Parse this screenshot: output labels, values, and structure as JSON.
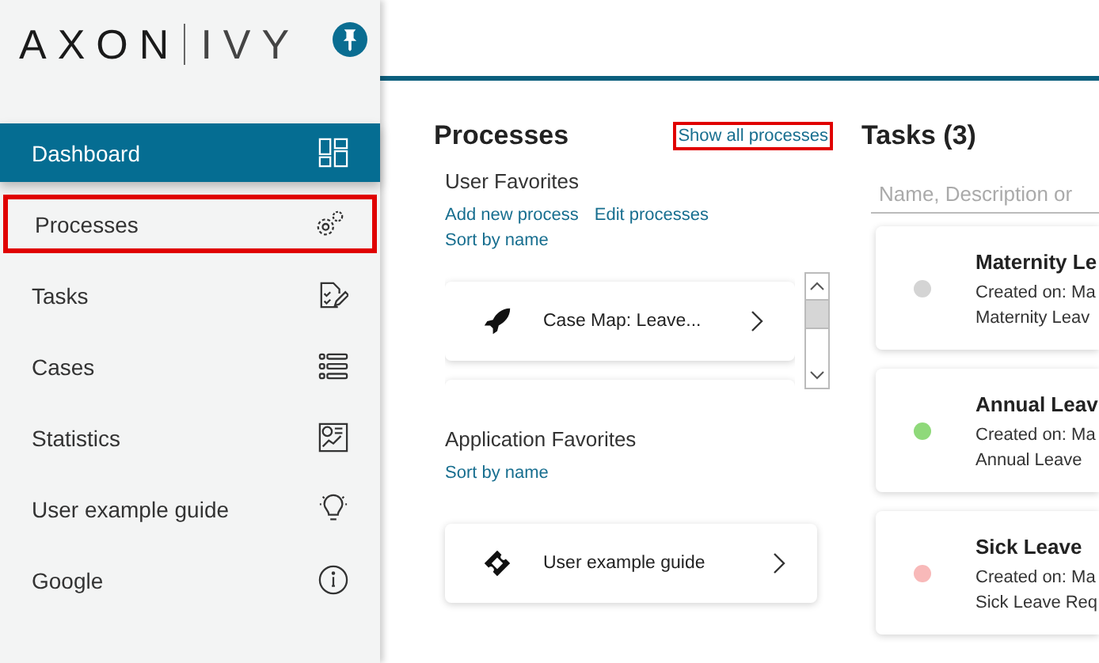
{
  "logo": {
    "left": "AXON",
    "right": "IVY"
  },
  "sidebar": {
    "items": [
      {
        "label": "Dashboard",
        "kind": "dashboard",
        "selected": true,
        "highlighted": false
      },
      {
        "label": "Processes",
        "kind": "gears",
        "selected": false,
        "highlighted": true
      },
      {
        "label": "Tasks",
        "kind": "task",
        "selected": false,
        "highlighted": false
      },
      {
        "label": "Cases",
        "kind": "list",
        "selected": false,
        "highlighted": false
      },
      {
        "label": "Statistics",
        "kind": "chart",
        "selected": false,
        "highlighted": false
      },
      {
        "label": "User example guide",
        "kind": "bulb",
        "selected": false,
        "highlighted": false
      },
      {
        "label": "Google",
        "kind": "info",
        "selected": false,
        "highlighted": false
      }
    ]
  },
  "processes": {
    "title": "Processes",
    "show_all": {
      "label": "Show all processes",
      "highlighted": true
    },
    "user_favorites": {
      "title": "User Favorites",
      "links": [
        "Add new process",
        "Edit processes"
      ],
      "sort": "Sort by name",
      "items": [
        {
          "label": "Case Map: Leave...",
          "kind": "rocket"
        }
      ]
    },
    "application_favorites": {
      "title": "Application Favorites",
      "sort": "Sort by name",
      "items": [
        {
          "label": "User example guide",
          "kind": "ticket"
        }
      ]
    }
  },
  "tasks": {
    "title": "Tasks (3)",
    "search": {
      "placeholder": "Name, Description or"
    },
    "items": [
      {
        "name": "Maternity Le",
        "created": "Created on: Ma",
        "description": "Maternity Leav",
        "color": "#d4d4d4"
      },
      {
        "name": "Annual Leav",
        "created": "Created on: Ma",
        "description": "Annual Leave",
        "color": "#8fd97a"
      },
      {
        "name": "Sick Leave",
        "created": "Created on: Ma",
        "description": "Sick Leave Req",
        "color": "#f8b9b9"
      }
    ]
  }
}
